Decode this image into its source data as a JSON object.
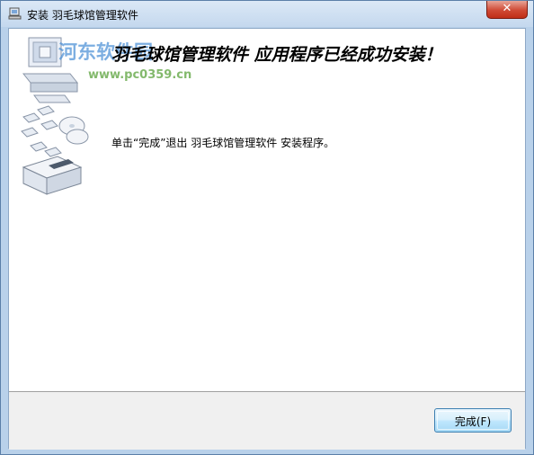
{
  "window": {
    "title": "安装 羽毛球馆管理软件",
    "close_glyph": "✕"
  },
  "watermark": {
    "site_name": "河东软件园",
    "url": "www.pc0359.cn"
  },
  "content": {
    "headline": "羽毛球馆管理软件 应用程序已经成功安装！",
    "instruction": "单击“完成”退出 羽毛球馆管理软件 安装程序。"
  },
  "buttons": {
    "finish_label": "完成(F)"
  },
  "icons": {
    "app_icon": "installer-icon",
    "hero_art": "computer-disks-installer-illustration"
  }
}
